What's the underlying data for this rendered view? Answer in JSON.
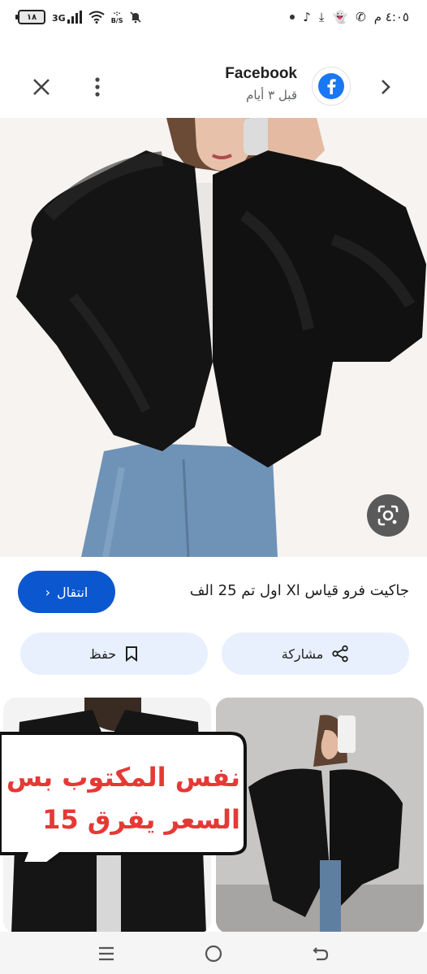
{
  "status_bar": {
    "battery_level": "١٨",
    "network_type": "3G",
    "speed_label": "B/S",
    "clock": "٤:٠٥ م"
  },
  "header": {
    "source_name": "Facebook",
    "posted_time": "قبل ٣ أيام",
    "accent_color": "#1877f2"
  },
  "item": {
    "title": "جاكيت فرو قياس Xl اول تم 25 الف",
    "visit_label": "انتقال"
  },
  "actions": {
    "share_label": "مشاركة",
    "save_label": "حفظ"
  },
  "sticker": {
    "line1": "نفس المكتوب بس",
    "line2": "السعر يفرق 15"
  },
  "colors": {
    "primary": "#0b57d0",
    "tonal": "#e8f0fe",
    "sticker_text": "#e53935"
  }
}
